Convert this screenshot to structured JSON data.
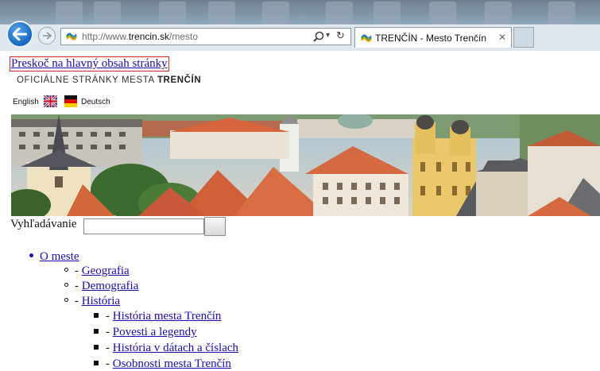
{
  "browser": {
    "url_prefix": "http://www.",
    "url_domain": "trencin.sk",
    "url_path": "/mesto",
    "tab_title": "TRENČÍN - Mesto Trenčín",
    "tab_close": "✕",
    "addr_dropdown": "▾",
    "addr_refresh": "↻",
    "icons": {
      "back": "back-arrow-icon",
      "forward": "forward-arrow-icon",
      "search": "search-icon",
      "refresh": "refresh-icon",
      "close": "close-icon"
    }
  },
  "page": {
    "skip_link": "Preskoč na hlavný obsah stránky",
    "site_title_prefix": "OFICIÁLNE STRÁNKY MESTA",
    "site_title_city": "TRENČÍN",
    "languages": {
      "english": "English",
      "deutsch": "Deutsch"
    },
    "search": {
      "label": "Vyhľadávanie",
      "value": "",
      "button_label": ""
    },
    "nav": {
      "top": {
        "label": "O meste"
      },
      "sub": [
        {
          "prefix": "- ",
          "label": "Geografia"
        },
        {
          "prefix": "- ",
          "label": "Demografia"
        },
        {
          "prefix": "- ",
          "label": "História"
        }
      ],
      "subsub": [
        {
          "prefix": "- ",
          "label": "História mesta Trenčín"
        },
        {
          "prefix": "- ",
          "label": "Povesti a legendy"
        },
        {
          "prefix": "- ",
          "label": "História v dátach a číslach"
        },
        {
          "prefix": "- ",
          "label": "Osobnosti mesta Trenčín"
        }
      ]
    },
    "colors": {
      "link": "#1a0dab",
      "skip_border": "#cc2a2a",
      "back_button": "#1565c0"
    }
  }
}
